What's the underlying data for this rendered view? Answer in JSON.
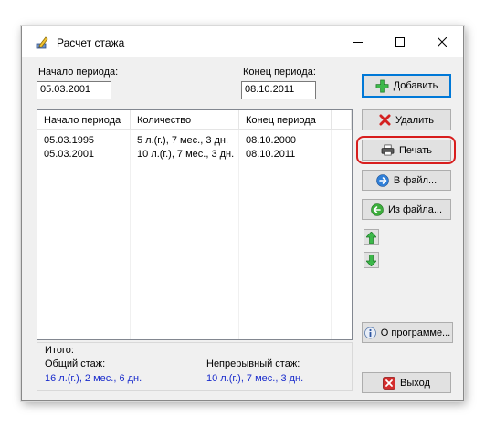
{
  "window": {
    "title": "Расчет стажа"
  },
  "period": {
    "start_label": "Начало периода:",
    "start_value": "05.03.2001",
    "end_label": "Конец периода:",
    "end_value": "08.10.2011"
  },
  "buttons": {
    "add": "Добавить",
    "delete": "Удалить",
    "print": "Печать",
    "to_file": "В файл...",
    "from_file": "Из файла...",
    "about": "О программе...",
    "exit": "Выход"
  },
  "table": {
    "columns": [
      "Начало периода",
      "Количество",
      "Конец периода"
    ],
    "rows": [
      [
        "05.03.1995",
        "5 л.(г.), 7 мес., 3 дн.",
        "08.10.2000"
      ],
      [
        "05.03.2001",
        "10 л.(г.), 7 мес., 3 дн.",
        "08.10.2011"
      ]
    ]
  },
  "summary": {
    "title": "Итого:",
    "total_label": "Общий стаж:",
    "total_value": "16 л.(г.), 2 мес., 6 дн.",
    "continuous_label": "Непрерывный стаж:",
    "continuous_value": "10 л.(г.), 7 мес., 3 дн."
  },
  "icons": {
    "app": "pencil-ruler-icon",
    "add": "green-plus-icon",
    "delete": "red-x-icon",
    "print": "printer-icon",
    "to_file": "blue-arrow-right-icon",
    "from_file": "green-arrow-left-icon",
    "move_up": "green-arrow-up-icon",
    "move_down": "green-arrow-down-icon",
    "about": "info-icon",
    "exit": "red-close-icon"
  },
  "colors": {
    "accent": "#0078d7",
    "summary_value": "#1a2ccc",
    "highlight": "#d81e1e"
  }
}
